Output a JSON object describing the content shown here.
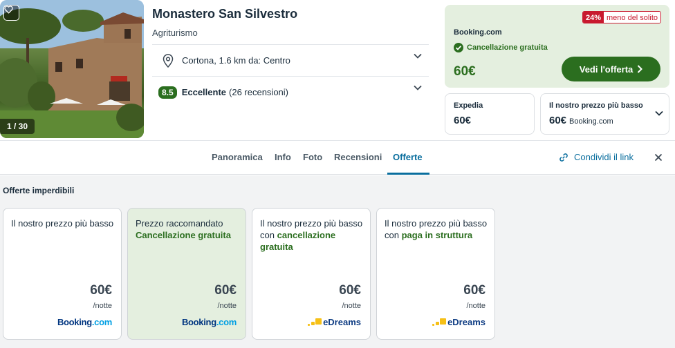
{
  "hotel": {
    "name": "Monastero San Silvestro",
    "type": "Agriturismo",
    "location": "Cortona, 1.6 km da: Centro",
    "rating_score": "8.5",
    "rating_label": "Eccellente",
    "rating_count": "(26 recensioni)",
    "photo_counter": "1 / 30"
  },
  "main_offer": {
    "discount_pct": "24%",
    "discount_text": "meno del solito",
    "provider": "Booking.com",
    "cancellation": "Cancellazione gratuita",
    "price": "60€",
    "cta_label": "Vedi l'offerta"
  },
  "alt_offers": [
    {
      "provider": "Expedia",
      "price": "60€",
      "sub": ""
    },
    {
      "provider": "Il nostro prezzo più basso",
      "price": "60€",
      "sub": "Booking.com"
    }
  ],
  "tabs": [
    {
      "label": "Panoramica",
      "active": false
    },
    {
      "label": "Info",
      "active": false
    },
    {
      "label": "Foto",
      "active": false
    },
    {
      "label": "Recensioni",
      "active": false
    },
    {
      "label": "Offerte",
      "active": true
    }
  ],
  "share_label": "Condividi il link",
  "deals": {
    "title": "Offerte imperdibili",
    "items": [
      {
        "text": "Il nostro prezzo più basso",
        "highlight": "",
        "price": "60€",
        "per": "/notte",
        "provider": "Booking.com"
      },
      {
        "text": "Prezzo raccomandato",
        "highlight": "Cancellazione gratuita",
        "price": "60€",
        "per": "/notte",
        "provider": "Booking.com"
      },
      {
        "text": "Il nostro prezzo più basso con",
        "highlight": "cancellazione gratuita",
        "price": "60€",
        "per": "/notte",
        "provider": "eDreams"
      },
      {
        "text": "Il nostro prezzo più basso con",
        "highlight": "paga in struttura",
        "price": "60€",
        "per": "/notte",
        "provider": "eDreams"
      }
    ]
  },
  "colors": {
    "brand_green": "#2b6e1f",
    "link_blue": "#0a6e9e",
    "discount_red": "#c8192e",
    "offer_bg": "#e4efdf"
  },
  "icons": [
    "heart-icon",
    "location-pin-icon",
    "chevron-down-icon",
    "check-circle-icon",
    "chevron-right-icon",
    "link-icon",
    "close-icon"
  ]
}
